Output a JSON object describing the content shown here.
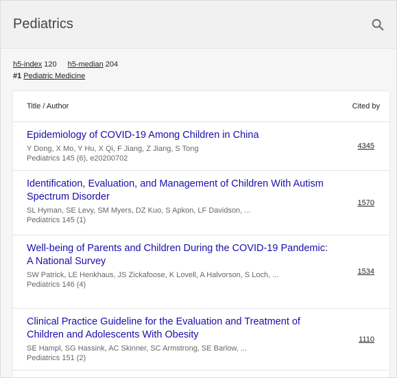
{
  "header": {
    "title": "Pediatrics",
    "search_icon": "search-icon"
  },
  "metrics": {
    "h5_index_label": "h5-index",
    "h5_index_value": "120",
    "h5_median_label": "h5-median",
    "h5_median_value": "204"
  },
  "rank": {
    "number": "#1",
    "category": "Pediatric Medicine"
  },
  "table": {
    "col_title": "Title / Author",
    "col_cited": "Cited by",
    "rows": [
      {
        "title": "Epidemiology of COVID-19 Among Children in China",
        "authors": "Y Dong, X Mo, Y Hu, X Qi, F Jiang, Z Jiang, S Tong",
        "journal": "Pediatrics 145 (6), e20200702",
        "cited": "4345"
      },
      {
        "title": "Identification, Evaluation, and Management of Children With Autism Spectrum Disorder",
        "authors": "SL Hyman, SE Levy, SM Myers, DZ Kuo, S Apkon, LF Davidson, ...",
        "journal": "Pediatrics 145 (1)",
        "cited": "1570"
      },
      {
        "title": "Well-being of Parents and Children During the COVID-19 Pandemic: A National Survey",
        "authors": "SW Patrick, LE Henkhaus, JS Zickafoose, K Lovell, A Halvorson, S Loch, ...",
        "journal": "Pediatrics 146 (4)",
        "cited": "1534"
      },
      {
        "title": "Clinical Practice Guideline for the Evaluation and Treatment of Children and Adolescents With Obesity",
        "authors": "SE Hampl, SG Hassink, AC Skinner, SC Armstrong, SE Barlow, ...",
        "journal": "Pediatrics 151 (2)",
        "cited": "1110"
      }
    ]
  }
}
